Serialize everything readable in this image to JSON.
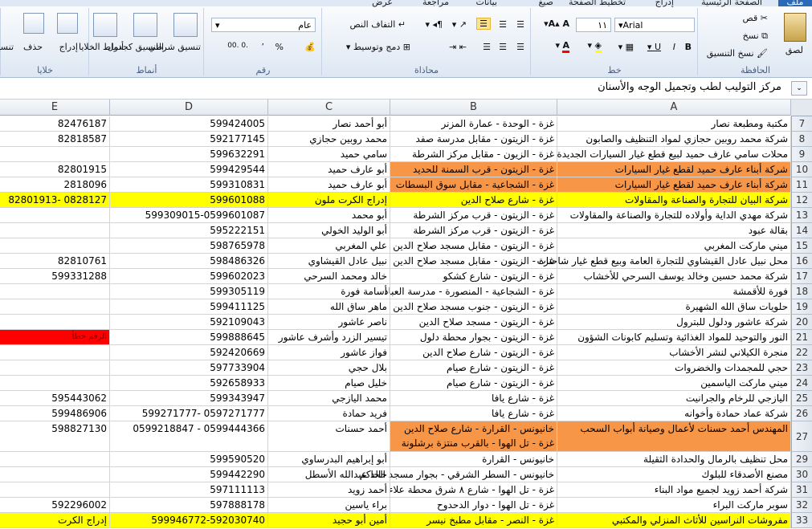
{
  "ribbon": {
    "tabs": [
      "ملف",
      "الصفحة الرئيسية",
      "إدراج",
      "تخطيط الصفحة",
      "صيغ",
      "بيانات",
      "مراجعة",
      "عرض"
    ],
    "clipboard": {
      "paste": "لصق",
      "cut": "قص",
      "copy": "نسخ",
      "format_painter": "نسخ التنسيق",
      "label": "الحافظة"
    },
    "font": {
      "name": "Arial",
      "size": "١١",
      "label": "خط"
    },
    "alignment": {
      "wrap": "التفاف النص",
      "merge": "دمج وتوسيط",
      "label": "محاذاة"
    },
    "number": {
      "format": "عام",
      "label": "رقم",
      "percent": "%",
      "comma": "٬"
    },
    "styles": {
      "conditional": "تنسيق شرطي",
      "table": "التنسيق كجدول",
      "cell": "أنماط الخلايا",
      "label": "أنماط"
    },
    "cells": {
      "insert": "إدراج",
      "delete": "حذف",
      "format": "تنسيق",
      "label": "خلايا"
    }
  },
  "formula_bar": {
    "content": "مركز التوليب لطب وتجميل الوجه والأسنان",
    "expand": "⌄"
  },
  "columns": [
    "A",
    "B",
    "C",
    "D",
    "E"
  ],
  "rows": [
    {
      "n": "7",
      "a": "مكتبة ومطبعة نصار",
      "b": "غزة - الوحدة - عمارة المزنر",
      "c": "أبو أحمد نصار",
      "d": "599424005",
      "e": "82476187",
      "hl": ""
    },
    {
      "n": "8",
      "a": "شركة محمد روبين حجازي لمواد التنظيف والصابون",
      "b": "غزة - الزيتون - مقابل مدرسة صفد",
      "c": "محمد روبين حجازي",
      "d": "592177145",
      "e": "82818587",
      "hl": ""
    },
    {
      "n": "9",
      "a": "محلات سامي عارف حميد لبيع قطع غيار السيارات الجديدة",
      "b": "غزة - الزيون - مقابل مركز الشرطة",
      "c": "سامي حميد",
      "d": "599632291",
      "e": "",
      "hl": ""
    },
    {
      "n": "10",
      "a": "شركة أبناء عارف حميد لقطع غيار السيارات",
      "b": "غزة - الزيتون - قرب السمنة للحديد",
      "c": "أبو عارف حميد",
      "d": "599429544",
      "e": "82801915",
      "hl": "orange"
    },
    {
      "n": "11",
      "a": "شركة أبناء عارف حميد لقطع غيار السيارات",
      "b": "غزة - الشجاعية - مقابل سوق البسطات",
      "c": "أبو عارف حميد",
      "d": "599310831",
      "e": "2818096",
      "hl": "orange"
    },
    {
      "n": "12",
      "a": "شركة البيان للتجارة والصناعة والمقاولات",
      "b": "غزة - شارع صلاح الدين",
      "c": "إدراج الكرت ملون",
      "d": "599601088",
      "e": "82801913- 0828127",
      "hl": "yellow"
    },
    {
      "n": "13",
      "a": "شركة مهدي الداية وأولاده للتجارة والصناعة والمقاولات",
      "b": "غزة - الزيتون - قرب مركز الشرطة",
      "c": "أبو محمد",
      "d": "599309015-0599601087",
      "e": "",
      "hl": ""
    },
    {
      "n": "14",
      "a": "بقالة عبود",
      "b": "غزة - الزيتون - قرب مركز الشرطة",
      "c": "أبو الوليد الخولي",
      "d": "595222151",
      "e": "",
      "hl": ""
    },
    {
      "n": "15",
      "a": "ميني ماركت المغربي",
      "b": "غزة - الزيتون - مقابل مسجد صلاح الدين",
      "c": "علي المغربي",
      "d": "598765978",
      "e": "",
      "hl": ""
    },
    {
      "n": "16",
      "a": "محل نبيل عادل القيشاوي للتجارة العامة وبيع قطع غيار شاحنات",
      "b": "غزة - الزيتون - مقابل مسجد صلاح الدين",
      "c": "نبيل عادل القيشاوي",
      "d": "598486326",
      "e": "82810761",
      "hl": ""
    },
    {
      "n": "17",
      "a": "شركة محمد حسين وخالد يوسف السرحي للأخشاب",
      "b": "غزة - الزيتون - شارع كشكو",
      "c": "خالد ومحمد السرحي",
      "d": "599602023",
      "e": "599331288",
      "hl": ""
    },
    {
      "n": "18",
      "a": "فورة للأقمشة",
      "b": "غزة - الشجاعية - المنصورة - مدرسة العباد",
      "c": "أسامة فورة",
      "d": "599305119",
      "e": "",
      "hl": ""
    },
    {
      "n": "19",
      "a": "حلويات ساق الله الشهيرة",
      "b": "غزة - الزيتون - جنوب مسجد صلاح الدين",
      "c": "ماهر ساق الله",
      "d": "599411125",
      "e": "",
      "hl": ""
    },
    {
      "n": "20",
      "a": "شركة عاشور ودلول للبترول",
      "b": "غزة - الزيتون - مسجد صلاح الدين",
      "c": "ناصر عاشور",
      "d": "592109043",
      "e": "",
      "hl": ""
    },
    {
      "n": "21",
      "a": "النور والتوحيد للمواد الغذائية وتسليم كابونات الشؤون",
      "b": "غزة - الزيتون - بجوار محطة دلول",
      "c": "تيسير الزرد وأشرف عاشور",
      "d": "599888645",
      "e": "الرقم خطأ",
      "hl": "red"
    },
    {
      "n": "22",
      "a": "منجرة الكيلاني لنشر الأخشاب",
      "b": "غزة - الزيتون - شارع صلاح الدين",
      "c": "فواز عاشور",
      "d": "592420669",
      "e": "",
      "hl": ""
    },
    {
      "n": "23",
      "a": "حجي للمجمدات والخضروات",
      "b": "غزة - الزيتون - شارع صيام",
      "c": "بلال حجي",
      "d": "597733904",
      "e": "",
      "hl": ""
    },
    {
      "n": "24",
      "a": "ميني ماركت الياسمين",
      "b": "غزة - الزيتون - شارع صيام",
      "c": "خليل صيام",
      "d": "592658933",
      "e": "",
      "hl": ""
    },
    {
      "n": "25",
      "a": "اليازجي للرخام والجرانيت",
      "b": "غزة - شارع يافا",
      "c": "محمد اليازجي",
      "d": "599343947",
      "e": "595443062",
      "hl": ""
    },
    {
      "n": "26",
      "a": "شركة عماد حمادة وأخوانه",
      "b": "غزة - شارع يافا",
      "c": "فريد حمادة",
      "d": "599271777- 0597271777",
      "e": "599486906",
      "hl": ""
    },
    {
      "n": "27",
      "a": "المهندس أحمد حسنات لأعمال وصيانة أبواب السحب",
      "b": "خانيونس - القرارة - شارع صلاح الدين",
      "b2": "غزة - تل الهوا - بالقرب منتزة برشلونة",
      "c": "أحمد حسنات",
      "d": "0599218847 - 0599444366",
      "e": "598827130",
      "hl": "orange",
      "tall": true
    },
    {
      "n": "28",
      "a": "",
      "b": "",
      "c": "",
      "d": "",
      "e": "",
      "hl": "",
      "hidden": true
    },
    {
      "n": "29",
      "a": "محل تنظيف بالرمال والحدادة الثقيلة",
      "b": "خانيونس - القرارة",
      "c": "أبو إبراهيم البدرساوي",
      "d": "599590520",
      "e": "",
      "hl": ""
    },
    {
      "n": "30",
      "a": "مصنع الأصدقاء للبلوك",
      "b": "خانيونس - السطر الشرقي - بجوار مسجد الحاكم",
      "c": "خالد عبدالله الأسطل",
      "d": "599442290",
      "e": "",
      "hl": ""
    },
    {
      "n": "31",
      "a": "شركة أحمد زويد لجميع مواد البناء",
      "b": "غزة - تل الهوا - شارع ٨ شرق محطة علاء",
      "c": "أحمد زويد",
      "d": "597111113",
      "e": "",
      "hl": ""
    },
    {
      "n": "32",
      "a": "سوبر ماركت البراء",
      "b": "غزة - تل الهوا - دوار الدحدوح",
      "c": "براء ياسين",
      "d": "597888178",
      "e": "592296002",
      "hl": ""
    },
    {
      "n": "33",
      "a": "مفروشات النراسين للأثاث المنزلي والمكتبي",
      "b": "غزة - النصر - مقابل مطبخ نيسر",
      "c": "أمين أبو حجيد",
      "d": "599946772-592030740",
      "e": "إدراج الكرت",
      "hl": "yellow"
    }
  ],
  "colors": {
    "orange": "#f79646",
    "yellow": "#ffff00",
    "red": "#ff0000"
  }
}
